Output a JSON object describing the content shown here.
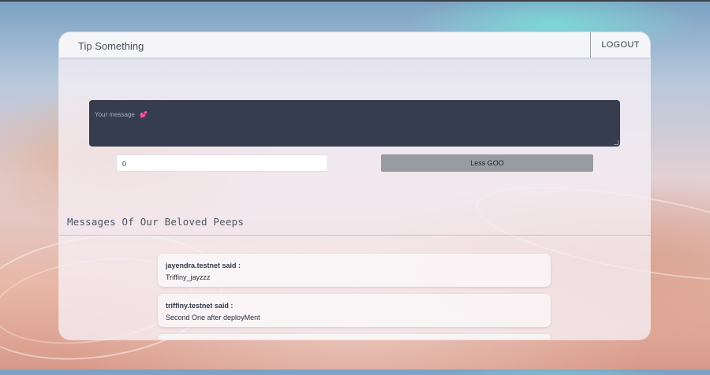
{
  "navbar": {
    "brand": "Tip Something",
    "logout_label": "LOGOUT"
  },
  "form": {
    "message_placeholder": "Your message",
    "message_placeholder_emoji": "💕",
    "amount_value": "0",
    "submit_label": "Less GOO"
  },
  "messages_section": {
    "title": "Messages Of Our Beloved Peeps",
    "items": [
      {
        "sender": "jayendra.testnet said :",
        "text": "Triffiny_jayzzz"
      },
      {
        "sender": "triffiny.testnet said :",
        "text": "Second One after deployMent"
      }
    ]
  }
}
